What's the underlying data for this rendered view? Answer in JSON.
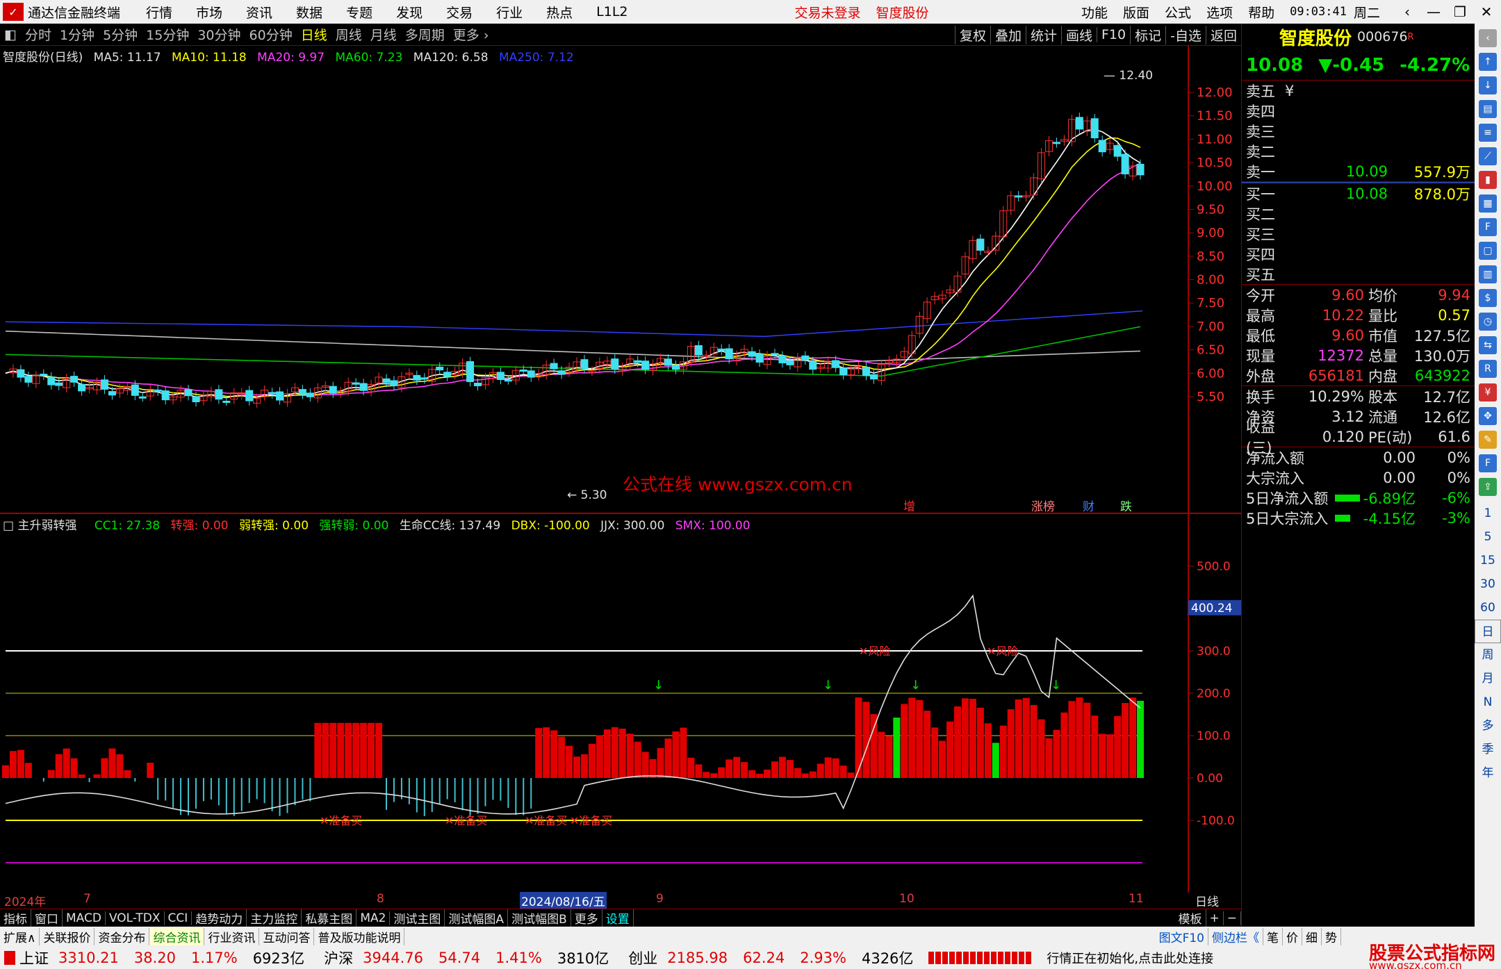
{
  "menubar": {
    "app_title": "通达信金融终端",
    "items": [
      "行情",
      "市场",
      "资讯",
      "数据",
      "专题",
      "发现",
      "交易",
      "行业",
      "热点",
      "L1L2"
    ],
    "alerts": [
      "交易未登录",
      "智度股份"
    ],
    "right_items": [
      "功能",
      "版面",
      "公式",
      "选项",
      "帮助"
    ],
    "clock": "09:03:41",
    "weekday": "周二"
  },
  "periods": {
    "items": [
      "分时",
      "1分钟",
      "5分钟",
      "15分钟",
      "30分钟",
      "60分钟",
      "日线",
      "周线",
      "月线",
      "多周期",
      "更多 ›"
    ],
    "active": "日线",
    "tools": [
      "复权",
      "叠加",
      "统计",
      "画线",
      "F10",
      "标记",
      "-自选",
      "返回"
    ]
  },
  "main_legend": {
    "title": "智度股份(日线)",
    "ma5": "MA5: 11.17",
    "ma10": "MA10: 11.18",
    "ma20": "MA20: 9.97",
    "ma60": "MA60: 7.23",
    "ma120": "MA120: 6.58",
    "ma250": "MA250: 7.12"
  },
  "main_axis": [
    "12.00",
    "11.50",
    "11.00",
    "10.50",
    "10.00",
    "9.50",
    "9.00",
    "8.50",
    "8.00",
    "7.50",
    "7.00",
    "6.50",
    "6.00",
    "5.50"
  ],
  "main_labels": {
    "high": "12.40",
    "low": "5.30",
    "watermark": "公式在线  www.gszx.com.cn",
    "tags": [
      "增",
      "涨榜",
      "财",
      "跌"
    ]
  },
  "ind_legend": {
    "title": "主升弱转强",
    "cc1": "CC1: 27.38",
    "zq": "转强: 0.00",
    "rzq": "弱转强: 0.00",
    "qzr": "强转弱: 0.00",
    "sm": "生命CC线: 137.49",
    "dbx": "DBX: -100.00",
    "jjx": "JJX: 300.00",
    "smx": "SMX: 100.00"
  },
  "ind_axis": [
    "500.0",
    "400.24",
    "300.0",
    "200.0",
    "100.0",
    "0.00",
    "-100.0"
  ],
  "ind_labels": {
    "buy": "准备买",
    "risk": "风险"
  },
  "date_axis": [
    "2024年",
    "7",
    "8",
    "2024/08/16/五",
    "9",
    "10",
    "11",
    "日线"
  ],
  "tabs1": [
    "指标",
    "窗口",
    "MACD",
    "VOL-TDX",
    "CCI",
    "趋势动力",
    "主力监控",
    "私募主图",
    "MA2",
    "测试主图",
    "测试幅图A",
    "测试幅图B",
    "更多",
    "设置",
    "模板",
    "+",
    "−"
  ],
  "tabs2": [
    "扩展∧",
    "关联报价",
    "资金分布",
    "综合资讯",
    "行业资讯",
    "互动问答",
    "普及版功能说明"
  ],
  "tabs2_right": [
    "图文F10",
    "侧边栏《",
    "笔",
    "价",
    "细",
    "势"
  ],
  "statusbar": {
    "sh": "上证",
    "sh_v": "3310.21",
    "sh_c": "38.20",
    "sh_p": "1.17%",
    "sh_a": "6923亿",
    "hs": "沪深",
    "hs_v": "3944.76",
    "hs_c": "54.74",
    "hs_p": "1.41%",
    "hs_a": "3810亿",
    "cy": "创业",
    "cy_v": "2185.98",
    "cy_c": "62.24",
    "cy_p": "2.93%",
    "cy_a": "4326亿",
    "msg": "行情正在初始化,点击此处连接",
    "brand": "股票公式指标网",
    "brand_url": "www.gszx.com.cn"
  },
  "quote": {
    "name": "智度股份",
    "code": "000676",
    "flag": "R",
    "price": "10.08",
    "change": "▼-0.45",
    "pct": "-4.27%",
    "asks": [
      {
        "l": "卖五",
        "v": "",
        "q": "¥"
      },
      {
        "l": "卖四",
        "v": "",
        "q": ""
      },
      {
        "l": "卖三",
        "v": "",
        "q": ""
      },
      {
        "l": "卖二",
        "v": "",
        "q": ""
      },
      {
        "l": "卖一",
        "v": "10.09",
        "q": "557.9万"
      }
    ],
    "bids": [
      {
        "l": "买一",
        "v": "10.08",
        "q": "878.0万"
      },
      {
        "l": "买二",
        "v": "",
        "q": ""
      },
      {
        "l": "买三",
        "v": "",
        "q": ""
      },
      {
        "l": "买四",
        "v": "",
        "q": ""
      },
      {
        "l": "买五",
        "v": "",
        "q": ""
      }
    ],
    "stats1": [
      {
        "l1": "今开",
        "v1": "9.60",
        "l2": "均价",
        "v2": "9.94"
      },
      {
        "l1": "最高",
        "v1": "10.22",
        "l2": "量比",
        "v2": "0.57"
      },
      {
        "l1": "最低",
        "v1": "9.60",
        "l2": "市值",
        "v2": "127.5亿"
      },
      {
        "l1": "现量",
        "v1": "12372",
        "l2": "总量",
        "v2": "130.0万"
      },
      {
        "l1": "外盘",
        "v1": "656181",
        "l2": "内盘",
        "v2": "643922"
      }
    ],
    "stats2": [
      {
        "l1": "换手",
        "v1": "10.29%",
        "l2": "股本",
        "v2": "12.7亿"
      },
      {
        "l1": "净资",
        "v1": "3.12",
        "l2": "流通",
        "v2": "12.6亿"
      },
      {
        "l1": "收益(三)",
        "v1": "0.120",
        "l2": "PE(动)",
        "v2": "61.6"
      }
    ],
    "flows": [
      {
        "l": "净流入额",
        "v": "0.00",
        "p": "0%"
      },
      {
        "l": "大宗流入",
        "v": "0.00",
        "p": "0%"
      },
      {
        "l": "5日净流入额",
        "v": "-6.89亿",
        "p": "-6%"
      },
      {
        "l": "5日大宗流入",
        "v": "-4.15亿",
        "p": "-3%"
      }
    ]
  },
  "sidebar_labels": [
    "1",
    "5",
    "15",
    "30",
    "60",
    "日",
    "周",
    "月",
    "N",
    "多",
    "季",
    "年"
  ]
}
